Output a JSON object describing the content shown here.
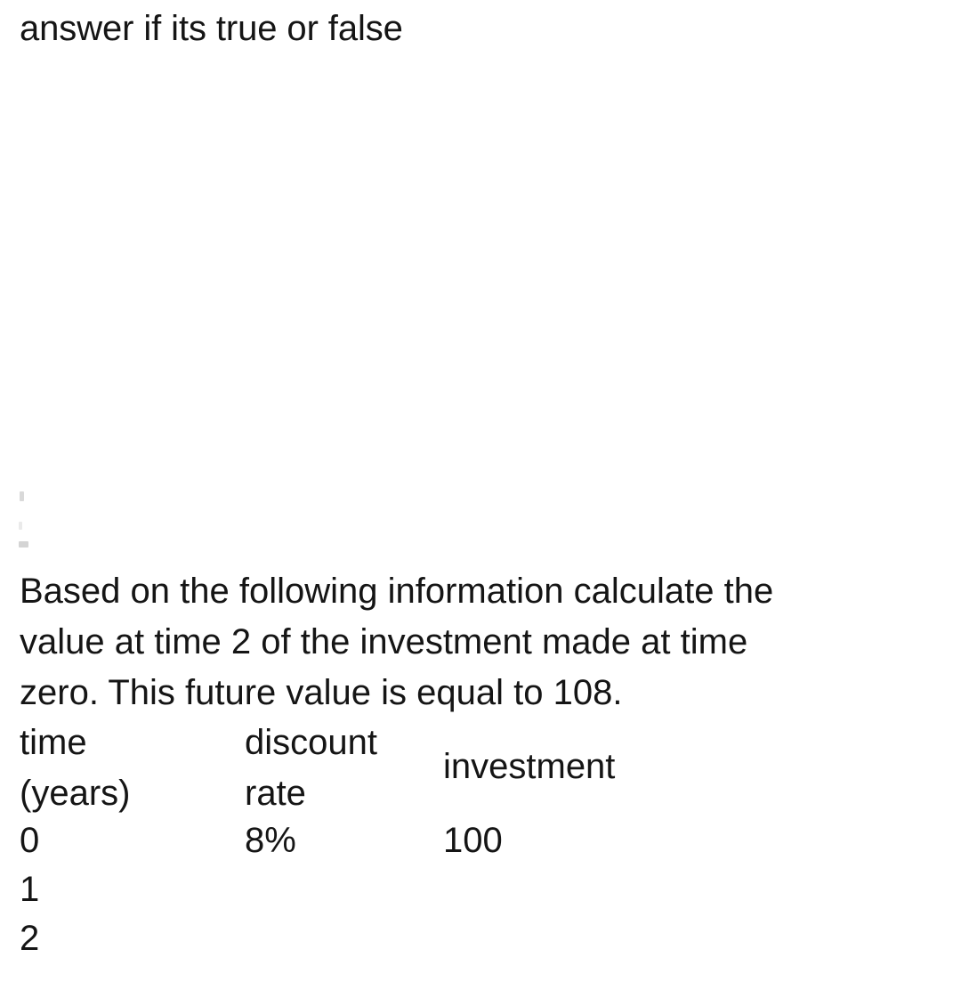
{
  "prompt": {
    "instruction": "answer if its true or false"
  },
  "question": {
    "line1": "Based on the following information calculate the",
    "line2": "value at time 2 of the investment made at time",
    "line3": "zero. This future value is equal to 108."
  },
  "table": {
    "headers": {
      "time": {
        "line1": "time",
        "line2": "(years)"
      },
      "rate": {
        "line1": "discount",
        "line2": "rate"
      },
      "investment": {
        "line1": "investment"
      }
    },
    "rows": [
      {
        "time": "0",
        "rate": "8%",
        "investment": "100"
      },
      {
        "time": "1",
        "rate": "",
        "investment": ""
      },
      {
        "time": "2",
        "rate": "",
        "investment": ""
      }
    ]
  },
  "colors": {
    "background": "#ffffff",
    "text": "#151515",
    "artifact": "#b9b9b9"
  }
}
